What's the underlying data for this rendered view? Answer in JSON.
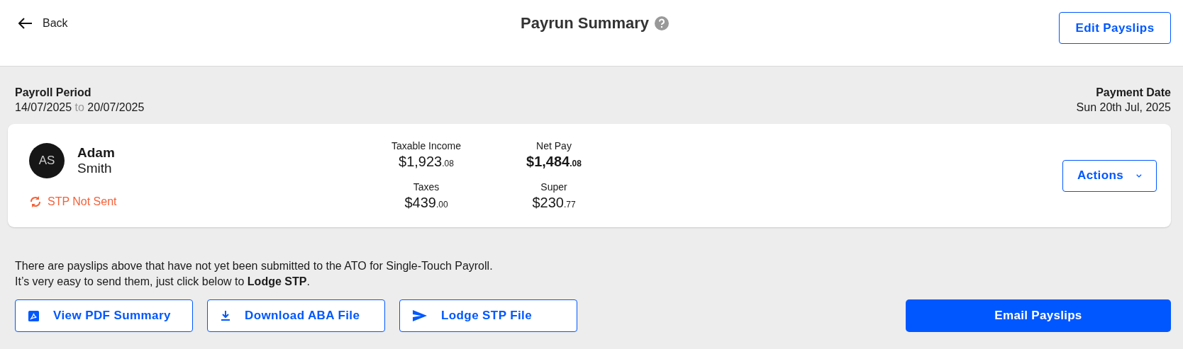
{
  "header": {
    "back_label": "Back",
    "title": "Payrun Summary",
    "edit_button": "Edit Payslips"
  },
  "period": {
    "label": "Payroll Period",
    "start": "14/07/2025",
    "separator": "to",
    "end": "20/07/2025"
  },
  "payment": {
    "label": "Payment Date",
    "date": "Sun 20th Jul, 2025"
  },
  "employee": {
    "initials": "AS",
    "first_name": "Adam",
    "last_name": "Smith",
    "stp_status": "STP Not Sent",
    "metrics": [
      {
        "label": "Taxable Income",
        "amount": "$1,923",
        "cents": ".08",
        "emphasis": false
      },
      {
        "label": "Net Pay",
        "amount": "$1,484",
        "cents": ".08",
        "emphasis": true
      },
      {
        "label": "Taxes",
        "amount": "$439",
        "cents": ".00",
        "emphasis": false
      },
      {
        "label": "Super",
        "amount": "$230",
        "cents": ".77",
        "emphasis": false
      }
    ],
    "actions_button": "Actions"
  },
  "message_lines": [
    "There are payslips above that have not yet been submitted to the ATO for Single-Touch Payroll.",
    "It’s very easy to send them, just click below to **Lodge STP**."
  ],
  "buttons": [
    {
      "kind": "pdf",
      "label": "View PDF Summary"
    },
    {
      "kind": "download",
      "label": "Download ABA File"
    },
    {
      "kind": "send",
      "label": "Lodge STP File"
    }
  ],
  "primary_button": "Email Payslips"
}
